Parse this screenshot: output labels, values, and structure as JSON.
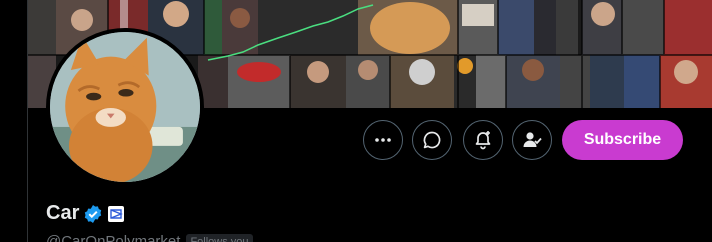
{
  "profile": {
    "display_name": "Car",
    "handle": "@CarOnPolymarket",
    "follows_you": "Follows you",
    "verified_icon": "verified-badge-icon",
    "affiliate_icon": "affiliate-logo-icon"
  },
  "actions": {
    "more_icon": "more-icon",
    "message_icon": "message-icon",
    "notify_icon": "notification-bell-icon",
    "following_icon": "following-person-icon",
    "subscribe_label": "Subscribe"
  },
  "colors": {
    "subscribe": "#c93bd0",
    "verified": "#1d9bf0",
    "button_border": "#536471",
    "chart_line": "#4ade80"
  }
}
